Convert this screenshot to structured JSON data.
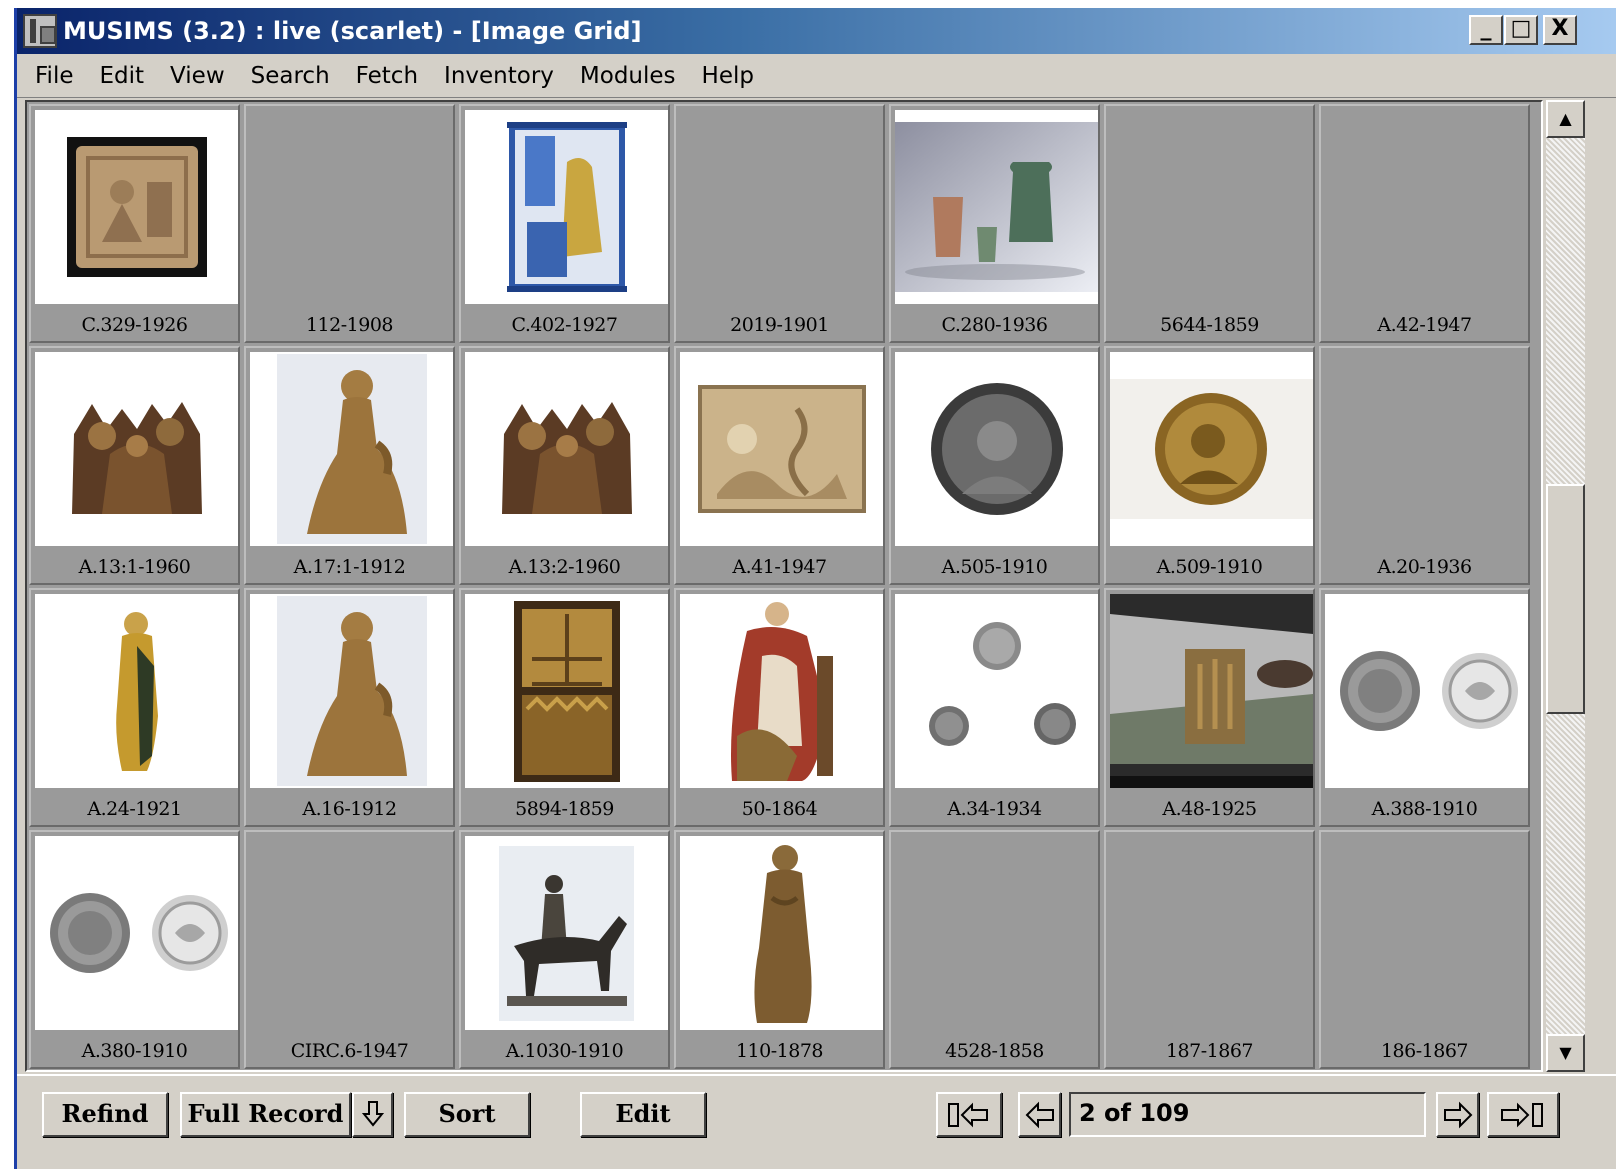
{
  "window": {
    "title": "MUSIMS (3.2) : live (scarlet) - [Image Grid]",
    "controls": {
      "minimize": "_",
      "maximize": "□",
      "close": "X"
    }
  },
  "menu": [
    "File",
    "Edit",
    "View",
    "Search",
    "Fetch",
    "Inventory",
    "Modules",
    "Help"
  ],
  "grid": {
    "rows": [
      [
        {
          "label": "C.329-1926",
          "image": "square-relief-tile",
          "has_image": true
        },
        {
          "label": "112-1908",
          "has_image": false
        },
        {
          "label": "C.402-1927",
          "image": "painted-tile-panel",
          "has_image": true
        },
        {
          "label": "2019-1901",
          "has_image": false
        },
        {
          "label": "C.280-1936",
          "image": "glass-vessels",
          "has_image": true
        },
        {
          "label": "5644-1859",
          "has_image": false
        },
        {
          "label": "A.42-1947",
          "has_image": false
        }
      ],
      [
        {
          "label": "A.13:1-1960",
          "image": "carved-wood-group",
          "has_image": true
        },
        {
          "label": "A.17:1-1912",
          "image": "kneeling-angel-figure",
          "has_image": true
        },
        {
          "label": "A.13:2-1960",
          "image": "carved-wood-group",
          "has_image": true
        },
        {
          "label": "A.41-1947",
          "image": "relief-plaque",
          "has_image": true
        },
        {
          "label": "A.505-1910",
          "image": "portrait-medal-dark",
          "has_image": true
        },
        {
          "label": "A.509-1910",
          "image": "portrait-medal-bronze",
          "has_image": true
        },
        {
          "label": "A.20-1936",
          "has_image": false
        }
      ],
      [
        {
          "label": "A.24-1921",
          "image": "gilded-saint-figure",
          "has_image": true
        },
        {
          "label": "A.16-1912",
          "image": "kneeling-angel-figure",
          "has_image": true
        },
        {
          "label": "5894-1859",
          "image": "carved-altar-panel",
          "has_image": true
        },
        {
          "label": "50-1864",
          "image": "painted-madonna-group",
          "has_image": true
        },
        {
          "label": "A.34-1934",
          "image": "three-coins",
          "has_image": true
        },
        {
          "label": "A.48-1925",
          "image": "plaquette-photo",
          "has_image": true
        },
        {
          "label": "A.388-1910",
          "image": "two-medals",
          "has_image": true
        }
      ],
      [
        {
          "label": "A.380-1910",
          "image": "two-medals",
          "has_image": true
        },
        {
          "label": "CIRC.6-1947",
          "has_image": false
        },
        {
          "label": "A.1030-1910",
          "image": "rider-on-donkey",
          "has_image": true
        },
        {
          "label": "110-1878",
          "image": "standing-wood-figure",
          "has_image": true
        },
        {
          "label": "4528-1858",
          "has_image": false
        },
        {
          "label": "187-1867",
          "has_image": false
        },
        {
          "label": "186-1867",
          "has_image": false
        }
      ]
    ]
  },
  "toolbar": {
    "refind": "Refind",
    "full_record": "Full Record",
    "full_record_menu_icon": "arrow-down-icon",
    "sort": "Sort",
    "edit": "Edit",
    "record_position": "2 of 109",
    "nav_icons": [
      "first-record-icon",
      "previous-record-icon",
      "next-record-icon",
      "last-record-icon"
    ]
  },
  "colors": {
    "title_gradient_start": "#0a246a",
    "title_gradient_end": "#a6caf0",
    "chrome": "#d4d0c8",
    "grid_background": "#9c9c9c"
  }
}
